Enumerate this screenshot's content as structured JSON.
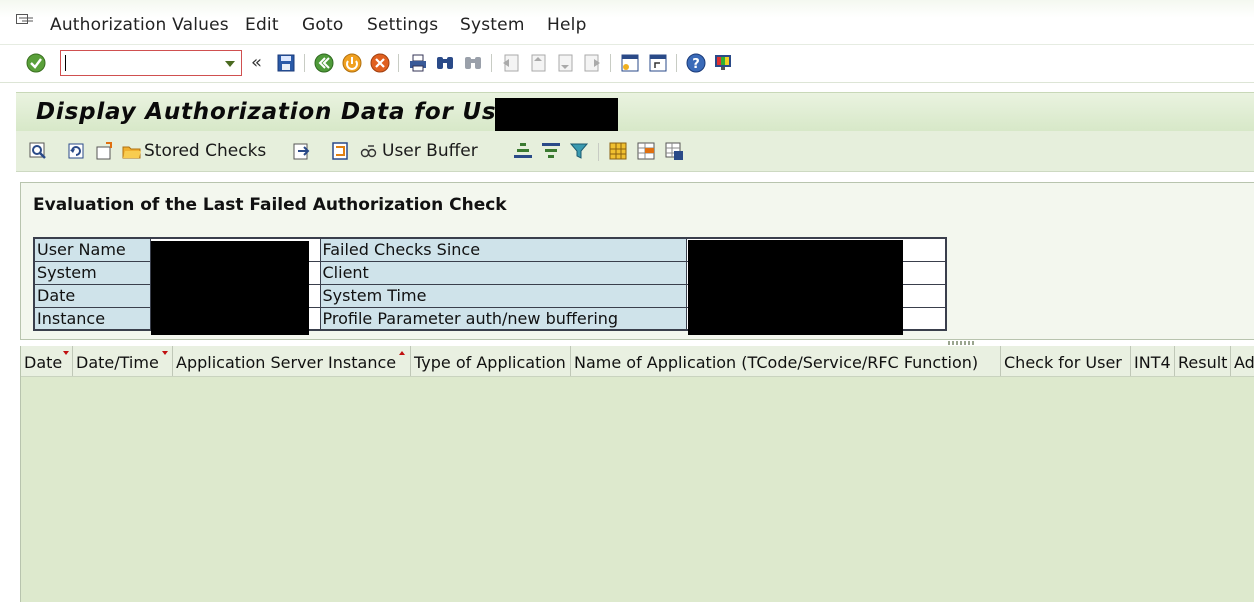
{
  "menu": {
    "items": [
      "Authorization Values",
      "Edit",
      "Goto",
      "Settings",
      "System",
      "Help"
    ]
  },
  "system_toolbar": {
    "command_field_value": "",
    "icons": [
      "enter-icon",
      "save-icon",
      "back-icon",
      "exit-icon",
      "cancel-icon",
      "print-icon",
      "find-icon",
      "find-next-icon",
      "first-page-icon",
      "previous-page-icon",
      "next-page-icon",
      "last-page-icon",
      "new-session-icon",
      "shortcut-icon",
      "help-icon",
      "customize-layout-icon"
    ]
  },
  "title": {
    "text": "Display Authorization Data for User"
  },
  "app_toolbar": {
    "stored_checks_label": "Stored Checks",
    "user_buffer_label": "User Buffer"
  },
  "evaluation": {
    "heading": "Evaluation of the Last Failed Authorization Check",
    "rows": [
      {
        "label": "User Name",
        "label2": "Failed Checks Since"
      },
      {
        "label": "System",
        "label2": "Client"
      },
      {
        "label": "Date",
        "label2": "System Time"
      },
      {
        "label": "Instance",
        "label2": "Profile Parameter auth/new buffering"
      }
    ]
  },
  "grid": {
    "columns": [
      {
        "label": "Date",
        "sort": "desc"
      },
      {
        "label": "Date/Time",
        "sort": "desc"
      },
      {
        "label": "Application Server Instance",
        "sort": "asc"
      },
      {
        "label": "Type of Application",
        "sort": ""
      },
      {
        "label": "Name of Application (TCode/Service/RFC Function)",
        "sort": ""
      },
      {
        "label": "Check for User",
        "sort": ""
      },
      {
        "label": "INT4",
        "sort": ""
      },
      {
        "label": "Result",
        "sort": ""
      },
      {
        "label": "Ad",
        "sort": ""
      }
    ]
  },
  "colors": {
    "title_bg": "#d7e8c8",
    "grid_bg": "#dde9cd",
    "label_cell_bg": "#cfe3ea",
    "sort_marker": "#c01010"
  }
}
